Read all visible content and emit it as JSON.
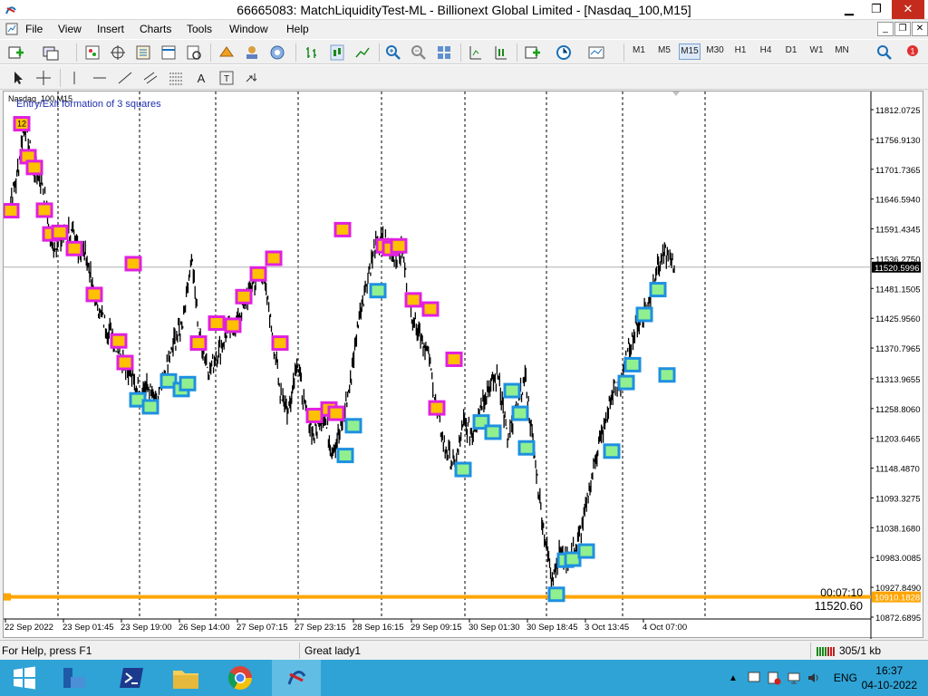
{
  "window": {
    "title": "66665083: MatchLiquidityTest-ML - Billionext Global Limited - [Nasdaq_100,M15]",
    "minimize": "▁",
    "maximize": "❐",
    "close": "✕"
  },
  "menu": {
    "items": [
      "File",
      "View",
      "Insert",
      "Charts",
      "Tools",
      "Window",
      "Help"
    ],
    "mdi_minimize": "_",
    "mdi_restore": "❐",
    "mdi_close": "✕"
  },
  "toolbar": {
    "timeframes": [
      "M1",
      "M5",
      "M15",
      "M30",
      "H1",
      "H4",
      "D1",
      "W1",
      "MN"
    ],
    "active_timeframe": "M15",
    "notification_count": "1"
  },
  "chart": {
    "symbol_label": "Nasdaq_100,M15",
    "indicator_label": "Entry/Exit formation of 3 squares",
    "top_marker": "12",
    "timer": "00:07:10",
    "last_price": "11520.60",
    "current_price_tag": "11520.5996",
    "orange_line_tag": "10910.1828",
    "colors": {
      "candles": "#000000",
      "exit_square_border": "#e020e0",
      "exit_square_fill": "#ffc000",
      "entry_square_border": "#1e90e0",
      "entry_square_fill": "#90f090",
      "orange_line": "#ffa500",
      "separator": "#000000"
    }
  },
  "chart_data": {
    "type": "candlestick",
    "symbol": "Nasdaq_100",
    "timeframe": "M15",
    "ylim": [
      10872.6895,
      11812.0725
    ],
    "y_ticks": [
      "11812.0725",
      "11756.9130",
      "11701.7365",
      "11646.5940",
      "11591.4345",
      "11536.2750",
      "11481.1505",
      "11425.9560",
      "11370.7965",
      "11313.9655",
      "11258.8060",
      "11203.6465",
      "11148.4870",
      "11093.3275",
      "11038.1680",
      "10983.0085",
      "10927.8490",
      "10872.6895"
    ],
    "x_ticks": [
      "22 Sep 2022",
      "23 Sep 01:45",
      "23 Sep 19:00",
      "26 Sep 14:00",
      "27 Sep 07:15",
      "27 Sep 23:15",
      "28 Sep 16:15",
      "29 Sep 09:15",
      "30 Sep 01:30",
      "30 Sep 18:45",
      "3 Oct 13:45",
      "4 Oct 07:00"
    ],
    "current_price": 11520.5996,
    "horizontal_line": 10910.1828,
    "close_path": [
      11620,
      11680,
      11790,
      11700,
      11680,
      11560,
      11570,
      11590,
      11560,
      11540,
      11460,
      11420,
      11390,
      11360,
      11320,
      11290,
      11300,
      11270,
      11320,
      11380,
      11420,
      11540,
      11380,
      11330,
      11360,
      11400,
      11410,
      11450,
      11490,
      11520,
      11420,
      11300,
      11250,
      11350,
      11250,
      11210,
      11250,
      11180,
      11220,
      11300,
      11420,
      11500,
      11560,
      11570,
      11540,
      11550,
      11440,
      11400,
      11360,
      11250,
      11180,
      11150,
      11230,
      11210,
      11270,
      11300,
      11320,
      11200,
      11250,
      11320,
      11180,
      11050,
      10950,
      10990,
      10980,
      11010,
      11080,
      11170,
      11220,
      11290,
      11310,
      11380,
      11420,
      11450,
      11520,
      11545,
      11520
    ],
    "exit_squares_value": [
      11625,
      11786,
      11725,
      11705,
      11626,
      11582,
      11585,
      11555,
      11470,
      11384,
      11344,
      11527,
      11380,
      11417,
      11413,
      11466,
      11508,
      11537,
      11380,
      11246,
      11258,
      11250,
      11590,
      11560,
      11555,
      11560,
      11460,
      11443,
      11260,
      11350
    ],
    "entry_squares_value": [
      11275,
      11262,
      11310,
      11294,
      11305,
      11172,
      11227,
      11477,
      11146,
      11234,
      11215,
      11292,
      11250,
      11186,
      10915,
      10978,
      10980,
      10995,
      11180,
      11307,
      11340,
      11433,
      11479,
      11321
    ]
  },
  "status": {
    "help": "For Help, press F1",
    "profile": "Great lady1",
    "traffic": "305/1 kb"
  },
  "taskbar": {
    "language": "ENG",
    "time": "16:37",
    "date": "04-10-2022"
  }
}
